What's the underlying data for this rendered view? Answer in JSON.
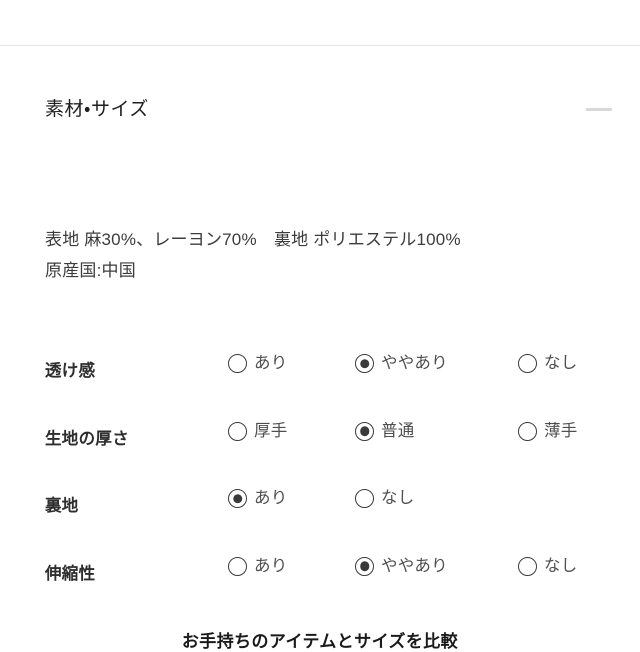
{
  "section": {
    "title": "素材・サイズ",
    "collapse_icon": "minus-icon"
  },
  "material": {
    "composition": "表地 麻30%、レーヨン70%　裏地 ポリエステル100%",
    "origin": "原産国:中国"
  },
  "attributes": [
    {
      "label": "透け感",
      "options": [
        {
          "text": "あり",
          "selected": false
        },
        {
          "text": "ややあり",
          "selected": true
        },
        {
          "text": "なし",
          "selected": false
        }
      ]
    },
    {
      "label": "生地の厚さ",
      "options": [
        {
          "text": "厚手",
          "selected": false
        },
        {
          "text": "普通",
          "selected": true
        },
        {
          "text": "薄手",
          "selected": false
        }
      ]
    },
    {
      "label": "裏地",
      "options": [
        {
          "text": "あり",
          "selected": true
        },
        {
          "text": "なし",
          "selected": false
        }
      ]
    },
    {
      "label": "伸縮性",
      "options": [
        {
          "text": "あり",
          "selected": false
        },
        {
          "text": "ややあり",
          "selected": true
        },
        {
          "text": "なし",
          "selected": false
        }
      ]
    }
  ],
  "compare_heading": "お手持ちのアイテムとサイズを比較",
  "colors": {
    "background": "#ffffff",
    "divider": "#e6e6e6",
    "title_text": "#1f1f1f",
    "body_text": "#3c3c3c",
    "label_text": "#2e2e2e",
    "option_text": "#4f4f4f",
    "radio_stroke": "#3a3a3a",
    "collapse_bar": "#d8d8d8"
  }
}
